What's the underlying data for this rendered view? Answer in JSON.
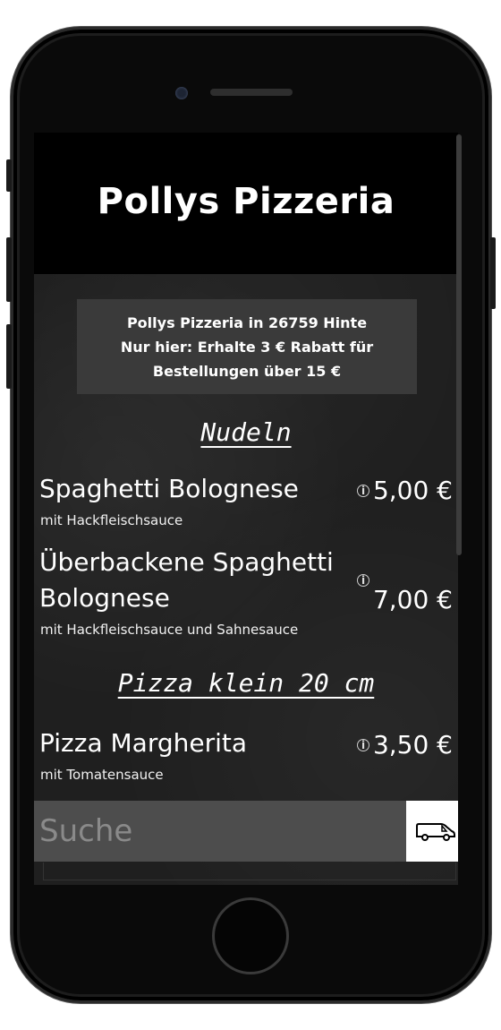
{
  "header": {
    "title": "Pollys Pizzeria"
  },
  "promo": {
    "lines": [
      "Pollys Pizzeria in 26759 Hinte",
      "Nur hier: Erhalte 3 € Rabatt für",
      "Bestellungen über 15 €"
    ]
  },
  "categories": [
    {
      "title": "Nudeln",
      "items": [
        {
          "name": "Spaghetti Bolognese",
          "description": "mit Hackfleischsauce",
          "price": "5,00 €"
        },
        {
          "name_line1": "Überbackene Spaghetti",
          "name_line2": "Bolognese",
          "description": "mit Hackfleischsauce und Sahnesauce",
          "price": "7,00 €"
        }
      ]
    },
    {
      "title": "Pizza klein 20 cm",
      "items": [
        {
          "name": "Pizza Margherita",
          "description": "mit Tomatensauce",
          "price": "3,50 €"
        }
      ]
    }
  ],
  "search": {
    "placeholder": "Suche"
  },
  "icons": {
    "info": "info-icon",
    "delivery": "delivery-van-icon"
  },
  "info_glyph": "i"
}
